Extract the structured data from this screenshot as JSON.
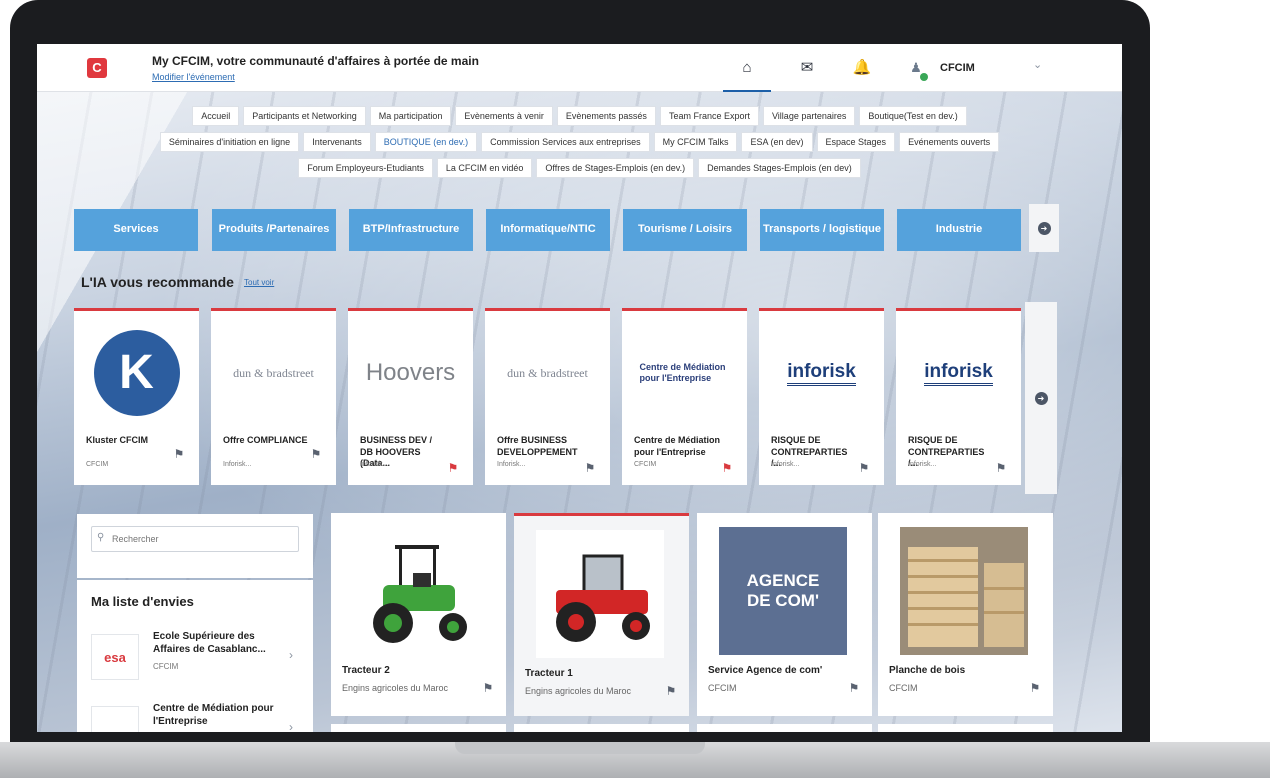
{
  "header": {
    "title": "My CFCIM, votre communauté d'affaires à portée de main",
    "subtitle": "Modifier l'événement",
    "user_name": "CFCIM",
    "icons": [
      "home-icon",
      "chat-icon",
      "bell-icon",
      "user-icon"
    ]
  },
  "nav": {
    "row1": [
      "Accueil",
      "Participants et Networking",
      "Ma participation",
      "Evènements à venir",
      "Evènements passés",
      "Team France Export",
      "Village partenaires",
      "Boutique(Test en dev.)"
    ],
    "row2": [
      "Séminaires d'initiation en ligne",
      "Intervenants",
      "BOUTIQUE (en dev.)",
      "Commission Services aux entreprises",
      "My CFCIM Talks",
      "ESA (en dev)",
      "Espace Stages",
      "Evénements ouverts"
    ],
    "row3": [
      "Forum Employeurs-Etudiants",
      "La CFCIM en vidéo",
      "Offres de Stages-Emplois (en dev.)",
      "Demandes Stages-Emplois (en dev)"
    ]
  },
  "categories": [
    "Services",
    "Produits /Partenaires",
    "BTP/Infrastructure",
    "Informatique/NTIC",
    "Tourisme / Loisirs",
    "Transports / logistique",
    "Industrie"
  ],
  "recommendations": {
    "title": "L'IA vous recommande",
    "link": "Tout voir",
    "items": [
      {
        "name": "Kluster CFCIM",
        "org": "CFCIM",
        "logo": "K"
      },
      {
        "name": "Offre COMPLIANCE",
        "org": "Inforisk...",
        "logo": "dun & bradstreet"
      },
      {
        "name": "BUSINESS DEV / DB HOOVERS (Data...",
        "org": "Inforisk...",
        "logo": "Hoovers"
      },
      {
        "name": "Offre BUSINESS DEVELOPPEMENT",
        "org": "Inforisk...",
        "logo": "dun & bradstreet"
      },
      {
        "name": "Centre de Médiation pour l'Entreprise",
        "org": "CFCIM",
        "logo": "Centre de Médiation pour l'Entreprise"
      },
      {
        "name": "RISQUE DE CONTREPARTIES /...",
        "org": "Inforisk...",
        "logo": "inforisk"
      },
      {
        "name": "RISQUE DE CONTREPARTIES /...",
        "org": "Inforisk...",
        "logo": "inforisk"
      }
    ]
  },
  "search": {
    "placeholder": "Rechercher"
  },
  "wishlist": {
    "title": "Ma liste d'envies",
    "items": [
      {
        "name": "Ecole Supérieure des Affaires de Casablanc...",
        "org": "CFCIM",
        "logo": "esa"
      },
      {
        "name": "Centre de Médiation pour l'Entreprise",
        "org": "",
        "logo": ""
      }
    ]
  },
  "products": [
    {
      "name": "Tracteur 2",
      "org": "Engins agricoles du Maroc"
    },
    {
      "name": "Tracteur 1",
      "org": "Engins agricoles du Maroc"
    },
    {
      "name": "Service Agence de com'",
      "org": "CFCIM",
      "image_text": "AGENCE DE COM'"
    },
    {
      "name": "Planche de bois",
      "org": "CFCIM"
    }
  ],
  "colors": {
    "accent": "#55a2dc",
    "brand": "#d93a3f",
    "link": "#2d6cb3"
  }
}
